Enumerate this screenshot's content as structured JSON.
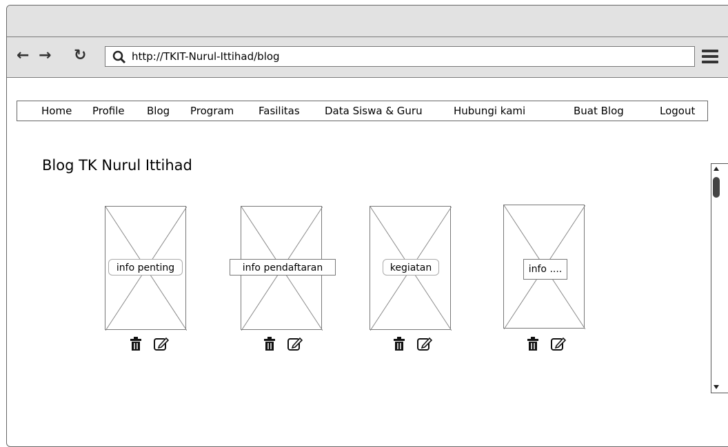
{
  "browser": {
    "url": "http://TKIT-Nurul-Ittihad/blog",
    "back_icon": "arrow-left-icon",
    "forward_icon": "arrow-right-icon",
    "reload_icon": "reload-icon",
    "menu_icon": "hamburger-menu-icon"
  },
  "nav": {
    "items": [
      {
        "label": "Home"
      },
      {
        "label": "Profile"
      },
      {
        "label": "Blog"
      },
      {
        "label": "Program"
      },
      {
        "label": "Fasilitas"
      },
      {
        "label": "Data Siswa & Guru"
      },
      {
        "label": "Hubungi kami"
      },
      {
        "label": "Buat Blog"
      },
      {
        "label": "Logout"
      }
    ]
  },
  "page": {
    "title": "Blog TK Nurul Ittihad"
  },
  "cards": [
    {
      "label": "info penting"
    },
    {
      "label": "info pendaftaran"
    },
    {
      "label": "kegiatan"
    },
    {
      "label": "info ...."
    }
  ],
  "colors": {
    "chrome": "#e2e2e2",
    "border": "#666666"
  }
}
